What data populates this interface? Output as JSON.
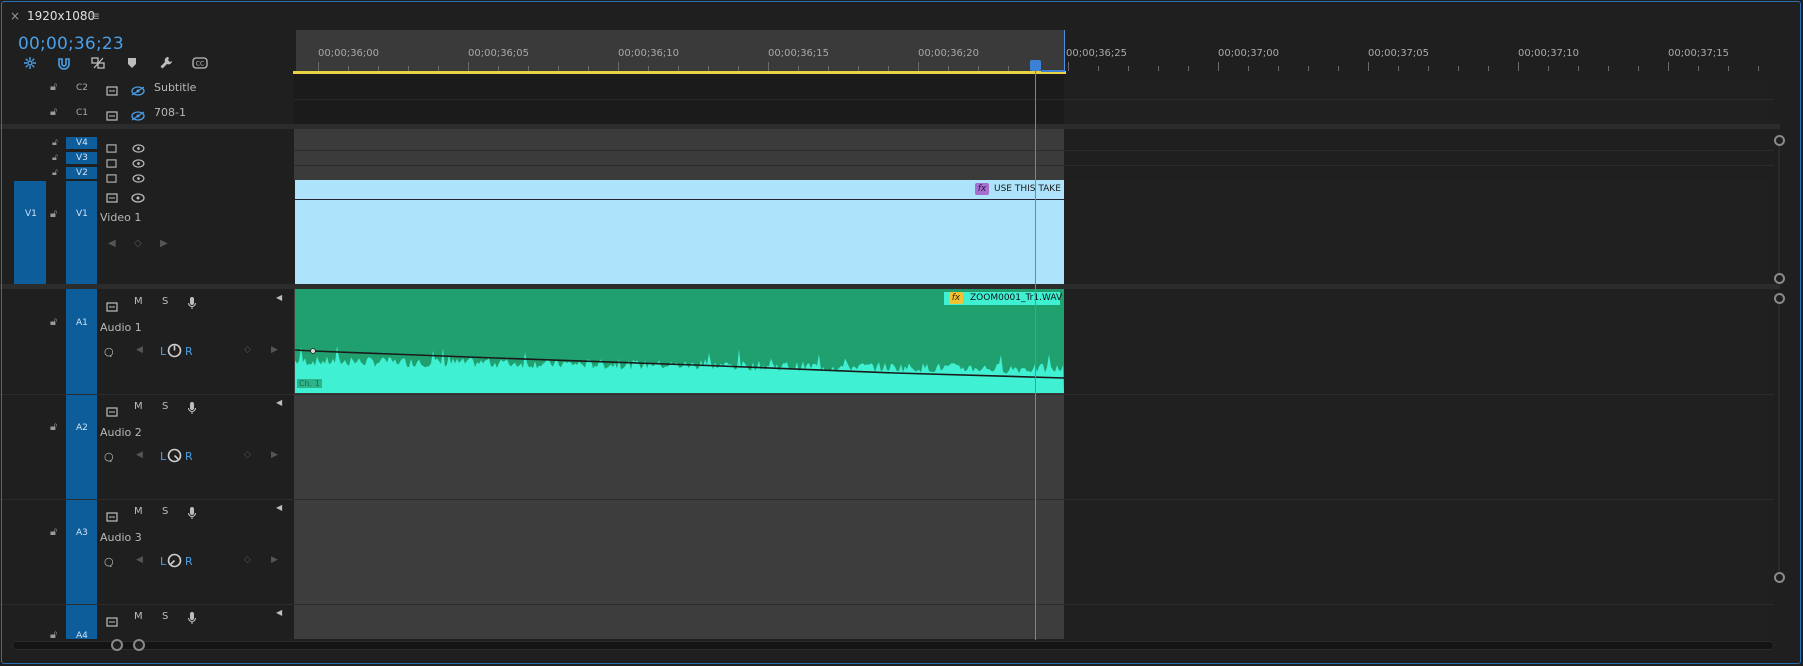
{
  "panel": {
    "title": "1920x1080",
    "close": "×",
    "menu": "≡"
  },
  "timecode": "00;00;36;23",
  "ruler": {
    "labels": [
      "00;00;36;00",
      "00;00;36;05",
      "00;00;36;10",
      "00;00;36;15",
      "00;00;36;20",
      "00;00;36;25",
      "00;00;37;00",
      "00;00;37;05",
      "00;00;37;10",
      "00;00;37;15"
    ]
  },
  "caption_tracks": [
    {
      "id": "C2",
      "name": "Subtitle"
    },
    {
      "id": "C1",
      "name": "708-1"
    }
  ],
  "video_tracks": [
    {
      "id": "V4"
    },
    {
      "id": "V3"
    },
    {
      "id": "V2"
    },
    {
      "id": "V1",
      "source": "V1",
      "name": "Video 1"
    }
  ],
  "audio_tracks": [
    {
      "id": "A1",
      "name": "Audio 1",
      "m": "M",
      "s": "S",
      "l": "L",
      "r": "R"
    },
    {
      "id": "A2",
      "name": "Audio 2",
      "m": "M",
      "s": "S",
      "l": "L",
      "r": "R"
    },
    {
      "id": "A3",
      "name": "Audio 3",
      "m": "M",
      "s": "S",
      "l": "L",
      "r": "R"
    },
    {
      "id": "A4",
      "m": "M",
      "s": "S"
    }
  ],
  "clips": {
    "video": {
      "label": "USE THIS TAKE",
      "fx": "fx"
    },
    "audio": {
      "label": "ZOOM0001_Tr1.WAV",
      "fx": "fx",
      "channel": "Ch. 1"
    }
  },
  "colors": {
    "accent": "#4a9fe8",
    "track_target": "#0d5d9b",
    "video_clip": "#aee4fb",
    "audio_clip": "#21a06f",
    "waveform": "#3ff0d2",
    "work_area": "#e8d442"
  },
  "icons": [
    "snap-icon",
    "linked-selection-icon",
    "add-marker-icon",
    "marker-icon",
    "wrench-icon",
    "captions-icon",
    "lock-icon",
    "toggle-sync-icon",
    "eye-icon",
    "microphone-icon",
    "keyframe-icon",
    "pan-knob-icon"
  ]
}
